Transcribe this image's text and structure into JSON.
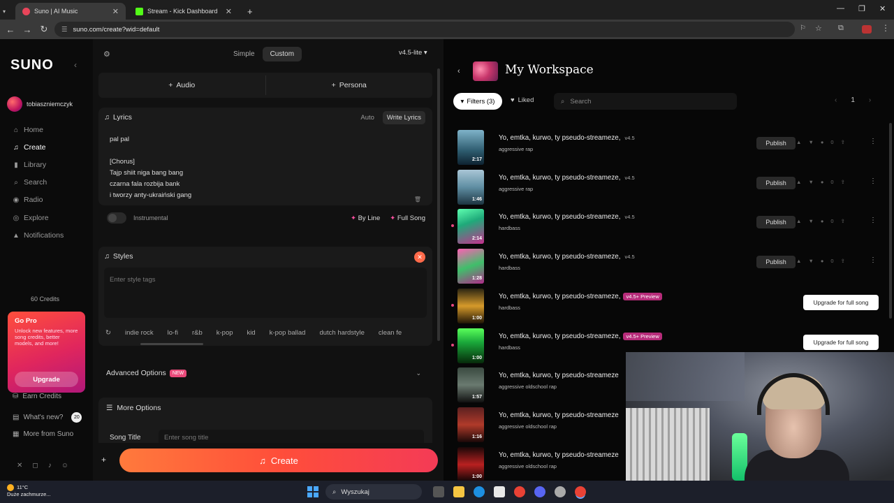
{
  "browser": {
    "tabs": [
      {
        "title": "Suno | AI Music",
        "active": true
      },
      {
        "title": "Stream - Kick Dashboard",
        "active": false
      }
    ],
    "url": "suno.com/create?wid=default",
    "new_tab": "+"
  },
  "sidebar": {
    "logo": "SUNO",
    "username": "tobiaszniemczyk",
    "nav": [
      {
        "label": "Home",
        "icon": "home-icon"
      },
      {
        "label": "Create",
        "icon": "music-note-icon",
        "active": true
      },
      {
        "label": "Library",
        "icon": "library-icon"
      },
      {
        "label": "Search",
        "icon": "search-icon"
      },
      {
        "label": "Radio",
        "icon": "radio-icon"
      },
      {
        "label": "Explore",
        "icon": "compass-icon"
      },
      {
        "label": "Notifications",
        "icon": "bell-icon"
      }
    ],
    "credits": "60 Credits",
    "gopro": {
      "title": "Go Pro",
      "description": "Unlock new features, more song credits, better models, and more!",
      "button": "Upgrade"
    },
    "secondary": [
      {
        "label": "Earn Credits"
      },
      {
        "label": "What's new?",
        "badge": "20"
      },
      {
        "label": "More from Suno"
      }
    ]
  },
  "create": {
    "modes": [
      "Simple",
      "Custom"
    ],
    "active_mode": "Custom",
    "model": "v4.5-lite",
    "add_audio": "Audio",
    "add_persona": "Persona",
    "lyrics": {
      "title": "Lyrics",
      "auto": "Auto",
      "write": "Write Lyrics",
      "lines": [
        "pal pal",
        "",
        "[Chorus]",
        "Tajp shiit niga bang bang",
        "czarna fala rozbija bank",
        "i tworzy anty-ukraiński gang"
      ]
    },
    "instrumental": "Instrumental",
    "by_line": "By Line",
    "full_song": "Full Song",
    "styles": {
      "title": "Styles",
      "placeholder": "Enter style tags",
      "tags": [
        "indie rock",
        "lo-fi",
        "r&b",
        "k-pop",
        "kid",
        "k-pop ballad",
        "dutch hardstyle",
        "clean fe"
      ]
    },
    "advanced": {
      "label": "Advanced Options",
      "badge": "NEW"
    },
    "more": {
      "label": "More Options",
      "song_title_label": "Song Title",
      "song_title_placeholder": "Enter song title"
    },
    "create_button": "Create"
  },
  "workspace": {
    "title": "My Workspace",
    "filters": "Filters (3)",
    "liked": "Liked",
    "search_placeholder": "Search",
    "page": "1",
    "publish_label": "Publish",
    "upgrade_label": "Upgrade for full song",
    "songs": [
      {
        "title": "Yo, emtka, kurwo, ty pseudo-streameze,",
        "version": "v4.5",
        "style": "aggressive rap",
        "duration": "2:17",
        "likes": "0",
        "action": "publish"
      },
      {
        "title": "Yo, emtka, kurwo, ty pseudo-streameze,",
        "version": "v4.5",
        "style": "aggressive rap",
        "duration": "1:46",
        "likes": "0",
        "action": "publish"
      },
      {
        "title": "Yo, emtka, kurwo, ty pseudo-streameze,",
        "version": "v4.5",
        "style": "hardbass",
        "duration": "2:14",
        "likes": "0",
        "action": "publish",
        "dot": true
      },
      {
        "title": "Yo, emtka, kurwo, ty pseudo-streameze,",
        "version": "v4.5",
        "style": "hardbass",
        "duration": "1:28",
        "likes": "0",
        "action": "publish"
      },
      {
        "title": "Yo, emtka, kurwo, ty pseudo-streameze,",
        "version": "v4.5+ Preview",
        "style": "hardbass",
        "duration": "1:00",
        "action": "upgrade",
        "dot": true
      },
      {
        "title": "Yo, emtka, kurwo, ty pseudo-streameze,",
        "version": "v4.5+ Preview",
        "style": "hardbass",
        "duration": "1:00",
        "action": "upgrade",
        "dot": true
      },
      {
        "title": "Yo, emtka, kurwo, ty pseudo-streameze",
        "style": "aggressive oldschool rap",
        "duration": "1:57"
      },
      {
        "title": "Yo, emtka, kurwo, ty pseudo-streameze",
        "style": "aggressive oldschool rap",
        "duration": "1:16"
      },
      {
        "title": "Yo, emtka, kurwo, ty pseudo-streameze",
        "style": "aggressive oldschool rap",
        "duration": "1:00"
      }
    ]
  },
  "taskbar": {
    "temperature": "11°C",
    "weather": "Duże zachmurze...",
    "search": "Wyszukaj"
  },
  "colors": {
    "accent": "#ff4e3a",
    "pink": "#ff4fa0",
    "bg": "#111111"
  }
}
